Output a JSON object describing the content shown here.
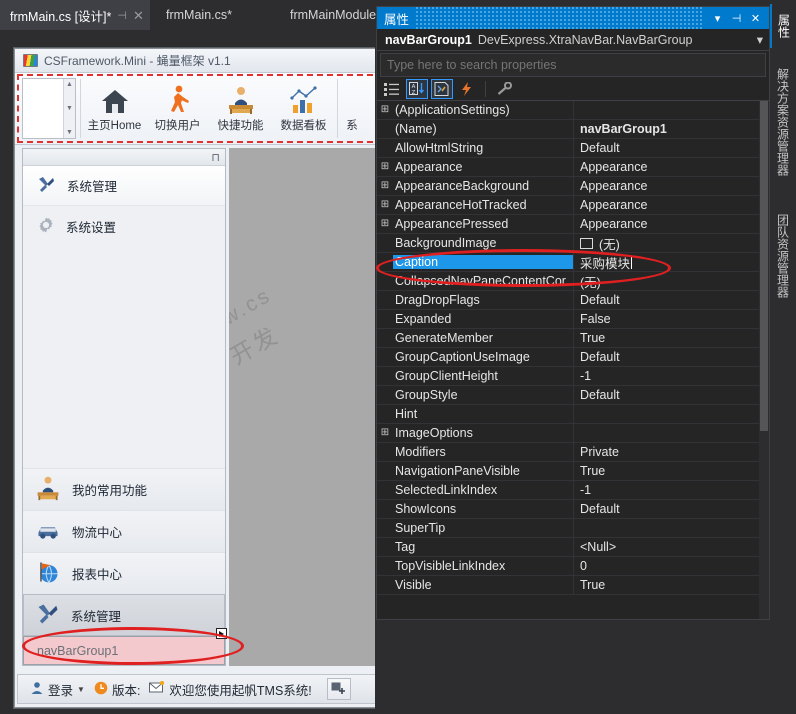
{
  "vs_tabs": [
    {
      "label": "frmMain.cs [设计]*",
      "active": true,
      "pin": "📌",
      "close": "✕"
    },
    {
      "label": "frmMain.cs*",
      "active": false
    },
    {
      "label": "frmMainModule",
      "active": false
    }
  ],
  "vertical_tabs": [
    {
      "label": "属性",
      "active": true
    },
    {
      "label": "解决方案资源管理器",
      "active": false
    },
    {
      "label": "团队资源管理器",
      "active": false
    }
  ],
  "app": {
    "title": "CSFramework.Mini - 蝇量框架 v1.1",
    "logo_text": "C|S",
    "ribbon": {
      "buttons": [
        {
          "label": "主页Home",
          "icon": "home-icon"
        },
        {
          "label": "切换用户",
          "icon": "walking-person-icon"
        },
        {
          "label": "快捷功能",
          "icon": "desk-person-icon"
        },
        {
          "label": "数据看板",
          "icon": "chart-icon"
        },
        {
          "label": "系",
          "icon": "partial-icon"
        }
      ]
    },
    "navbar": {
      "links": [
        {
          "label": "系统管理",
          "icon": "tools-icon"
        },
        {
          "label": "系统设置",
          "icon": "gear-icon"
        }
      ],
      "groups": [
        {
          "label": "我的常用功能",
          "icon": "desk-person-icon",
          "selected": false
        },
        {
          "label": "物流中心",
          "icon": "car-icon",
          "selected": false
        },
        {
          "label": "报表中心",
          "icon": "globe-flag-icon",
          "selected": false
        },
        {
          "label": "系统管理",
          "icon": "tools-icon",
          "selected": true
        }
      ],
      "new_group": "navBarGroup1"
    },
    "watermark_line1": "www.cs",
    "watermark_line2": "开发",
    "statusbar": {
      "login": "登录",
      "caret": "▼",
      "version": "版本:",
      "welcome": "欢迎您使用起帆TMS系统!",
      "new_icon": "new-window-icon"
    }
  },
  "properties_panel": {
    "title": "属性",
    "title_buttons": [
      {
        "name": "dropdown-icon",
        "glyph": "▾"
      },
      {
        "name": "pin-icon",
        "glyph": "⊣"
      },
      {
        "name": "close-icon",
        "glyph": "✕"
      }
    ],
    "object_name": "navBarGroup1",
    "object_type": "DevExpress.XtraNavBar.NavBarGroup",
    "object_caret": "▾",
    "search_placeholder": "Type here to search properties",
    "toolbar": [
      {
        "name": "categorized-view-button",
        "active": false
      },
      {
        "name": "alphabetical-sort-button",
        "active": true
      },
      {
        "name": "properties-view-button",
        "active": true
      },
      {
        "name": "events-view-button",
        "active": false
      },
      {
        "name": "property-pages-button",
        "active": false
      }
    ],
    "accent_color": "#007acc",
    "selection_color": "#1c97ea",
    "rows": [
      {
        "expand": true,
        "name": "(ApplicationSettings)",
        "value": "",
        "bold": false
      },
      {
        "expand": false,
        "name": "(Name)",
        "value": "navBarGroup1",
        "bold": true
      },
      {
        "expand": false,
        "name": "AllowHtmlString",
        "value": "Default",
        "bold": false
      },
      {
        "expand": true,
        "name": "Appearance",
        "value": "Appearance",
        "bold": false
      },
      {
        "expand": true,
        "name": "AppearanceBackground",
        "value": "Appearance",
        "bold": false
      },
      {
        "expand": true,
        "name": "AppearanceHotTracked",
        "value": "Appearance",
        "bold": false
      },
      {
        "expand": true,
        "name": "AppearancePressed",
        "value": "Appearance",
        "bold": false
      },
      {
        "expand": false,
        "name": "BackgroundImage",
        "value": "(无)",
        "swatch": true
      },
      {
        "expand": false,
        "name": "Caption",
        "value": "采购模块",
        "selected": true,
        "editing": true
      },
      {
        "expand": false,
        "name": "CollapsedNavPaneContentCor",
        "value": "(无)",
        "bold": false
      },
      {
        "expand": false,
        "name": "DragDropFlags",
        "value": "Default",
        "bold": false
      },
      {
        "expand": false,
        "name": "Expanded",
        "value": "False",
        "bold": false
      },
      {
        "expand": false,
        "name": "GenerateMember",
        "value": "True",
        "bold": false
      },
      {
        "expand": false,
        "name": "GroupCaptionUseImage",
        "value": "Default",
        "bold": false
      },
      {
        "expand": false,
        "name": "GroupClientHeight",
        "value": "-1",
        "bold": false
      },
      {
        "expand": false,
        "name": "GroupStyle",
        "value": "Default",
        "bold": false
      },
      {
        "expand": false,
        "name": "Hint",
        "value": "",
        "bold": false
      },
      {
        "expand": true,
        "name": "ImageOptions",
        "value": "",
        "bold": false
      },
      {
        "expand": false,
        "name": "Modifiers",
        "value": "Private",
        "bold": false
      },
      {
        "expand": false,
        "name": "NavigationPaneVisible",
        "value": "True",
        "bold": false
      },
      {
        "expand": false,
        "name": "SelectedLinkIndex",
        "value": "-1",
        "bold": false
      },
      {
        "expand": false,
        "name": "ShowIcons",
        "value": "Default",
        "bold": false
      },
      {
        "expand": false,
        "name": "SuperTip",
        "value": "",
        "bold": false
      },
      {
        "expand": false,
        "name": "Tag",
        "value": "<Null>",
        "bold": false
      },
      {
        "expand": false,
        "name": "TopVisibleLinkIndex",
        "value": "0",
        "bold": false
      },
      {
        "expand": false,
        "name": "Visible",
        "value": "True",
        "bold": false
      }
    ]
  },
  "annotations": {
    "color": "#e02020",
    "ribbon_highlight": "dashed-rectangle",
    "caption_ellipse": "red-ellipse",
    "navbargroup_ellipse": "red-ellipse"
  }
}
